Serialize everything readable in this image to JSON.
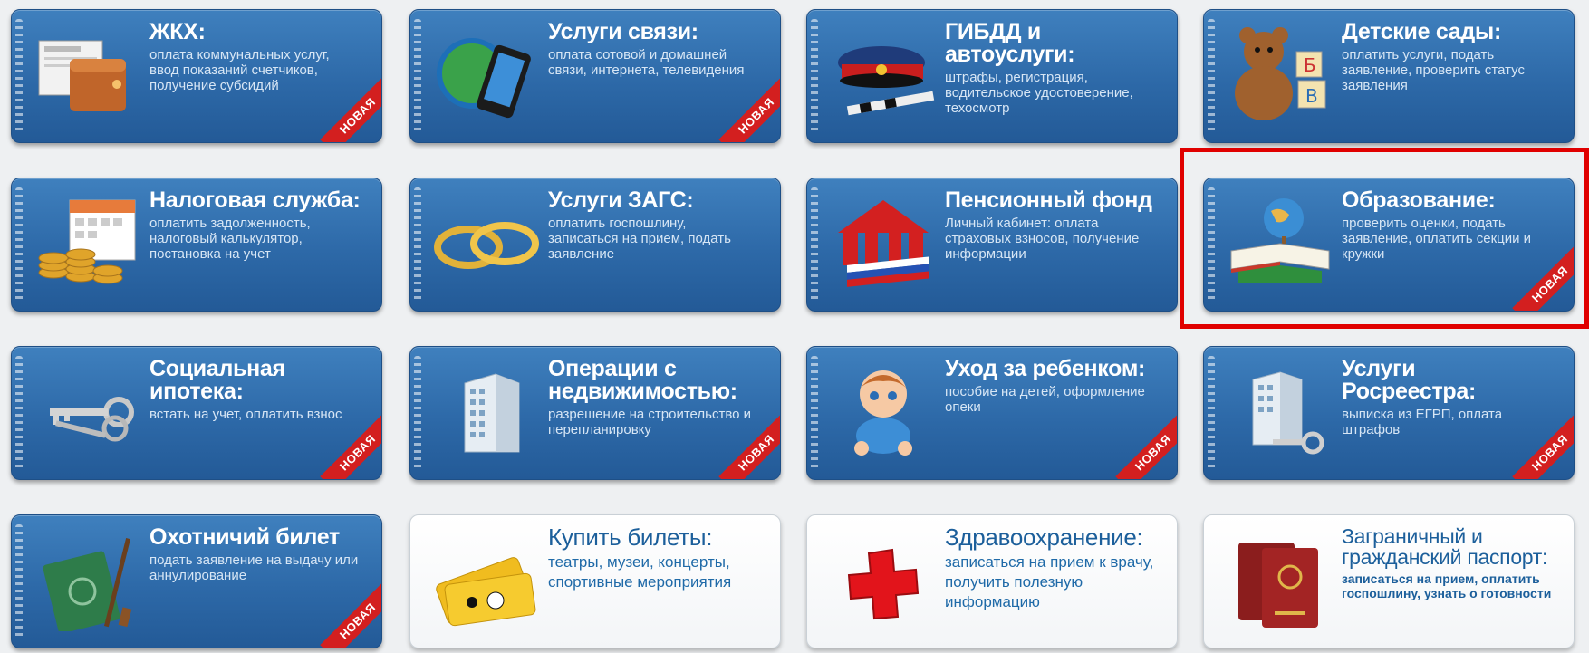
{
  "tiles": [
    {
      "title": "ЖКХ:",
      "desc": "оплата коммунальных услуг, ввод показаний счетчиков, получение субсидий",
      "badge": "НОВАЯ",
      "icon": "wallet-bill-icon"
    },
    {
      "title": "Услуги связи:",
      "desc": "оплата сотовой и домашней связи, интернета, телевидения",
      "badge": "НОВАЯ",
      "icon": "globe-phone-icon"
    },
    {
      "title": "ГИБДД и автоуслуги:",
      "desc": "штрафы, регистрация, водительское удостоверение, техосмотр",
      "badge": "",
      "icon": "police-cap-icon"
    },
    {
      "title": "Детские сады:",
      "desc": "оплатить услуги, подать заявление, проверить статус заявления",
      "badge": "",
      "icon": "teddy-bear-icon"
    },
    {
      "title": "Налоговая служба:",
      "desc": "оплатить задолженность, налоговый калькулятор, постановка на учет",
      "badge": "",
      "icon": "calendar-coins-icon"
    },
    {
      "title": "Услуги ЗАГС:",
      "desc": "оплатить госпошлину, записаться на прием, подать заявление",
      "badge": "",
      "icon": "rings-icon"
    },
    {
      "title": "Пенсионный фонд",
      "desc": "Личный кабинет: оплата страховых взносов, получение информации",
      "badge": "",
      "icon": "pension-fund-logo-icon"
    },
    {
      "title": "Образование:",
      "desc": "проверить оценки, подать заявление, оплатить секции и кружки",
      "badge": "НОВАЯ",
      "icon": "globe-book-icon"
    },
    {
      "title": "Социальная ипотека:",
      "desc": "встать на учет, оплатить взнос",
      "badge": "НОВАЯ",
      "icon": "keys-icon"
    },
    {
      "title": "Операции с недвижимостью:",
      "desc": "разрешение на строительство и перепланировку",
      "badge": "НОВАЯ",
      "icon": "building-icon"
    },
    {
      "title": "Уход за ребенком:",
      "desc": "пособие на детей, оформление опеки",
      "badge": "НОВАЯ",
      "icon": "baby-icon"
    },
    {
      "title": "Услуги Росреестра:",
      "desc": "выписка из ЕГРП, оплата штрафов",
      "badge": "НОВАЯ",
      "icon": "building-keys-icon"
    },
    {
      "title": "Охотничий билет",
      "desc": "подать заявление на выдачу или аннулирование",
      "badge": "НОВАЯ",
      "icon": "hunting-license-icon"
    },
    {
      "title": "Купить билеты:",
      "desc": "театры, музеи, концерты, спортивные мероприятия",
      "badge": "",
      "icon": "tickets-icon"
    },
    {
      "title": "Здравоохранение:",
      "desc": "записаться на прием к врачу, получить полезную информацию",
      "badge": "",
      "icon": "red-cross-icon"
    },
    {
      "title": "Заграничный и гражданский паспорт:",
      "desc": "записаться на прием, оплатить госпошлину, узнать о готовности",
      "badge": "",
      "icon": "passport-icon"
    }
  ],
  "colors": {
    "tile_blue": "#2d69a8",
    "tile_white": "#ffffff",
    "badge_red": "#d31f1f",
    "highlight_red": "#e00000"
  },
  "highlighted_tile": "Образование:"
}
